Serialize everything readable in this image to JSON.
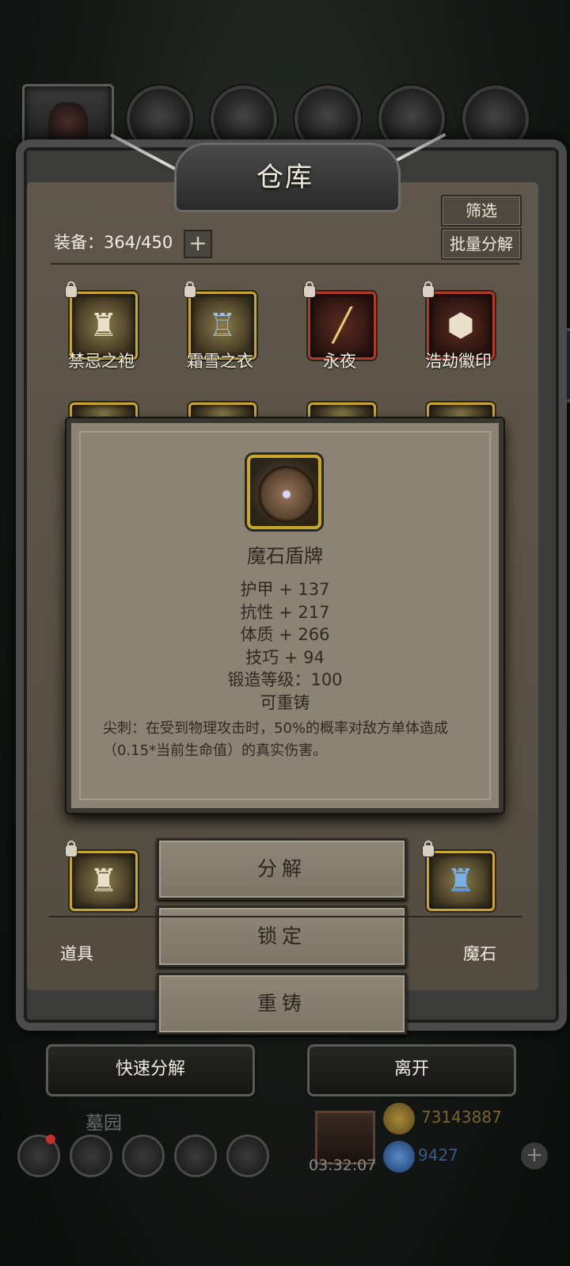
{
  "header": {
    "title": "仓库",
    "filter_label": "筛选",
    "batch_decompose_label": "批量分解",
    "capacity_label": "装备：364/450",
    "add_label": "+"
  },
  "equipment": [
    {
      "name": "禁忌之袍",
      "frame": "gold",
      "locked": true,
      "icon": "robe-icon"
    },
    {
      "name": "霜雪之衣",
      "frame": "gold",
      "locked": true,
      "icon": "cloak-icon"
    },
    {
      "name": "永夜",
      "frame": "red",
      "locked": true,
      "icon": "dagger-icon"
    },
    {
      "name": "浩劫徽印",
      "frame": "red",
      "locked": true,
      "icon": "seal-icon"
    }
  ],
  "tooltip": {
    "item_name": "魔石盾牌",
    "icon": "shield-icon",
    "stats": [
      "护甲 + 137",
      "抗性 + 217",
      "体质 + 266",
      "技巧 + 94",
      "锻造等级：100",
      "可重铸"
    ],
    "description": "尖刺：在受到物理攻击时，50%的概率对敌方单体造成（0.15*当前生命值）的真实伤害。"
  },
  "actions": {
    "decompose": "分解",
    "lock": "锁定",
    "reforge": "重铸"
  },
  "tabs": {
    "items": "道具",
    "magic_stone": "魔石"
  },
  "footer": {
    "quick_decompose": "快速分解",
    "leave": "离开"
  },
  "dock": {
    "location": "墓园",
    "timer": "03:32:07",
    "gold": "73143887",
    "gems": "9427"
  },
  "colors": {
    "frame_gold": "#c8a630",
    "frame_red": "#b23a26",
    "tooltip_bg": "#8b8373"
  }
}
